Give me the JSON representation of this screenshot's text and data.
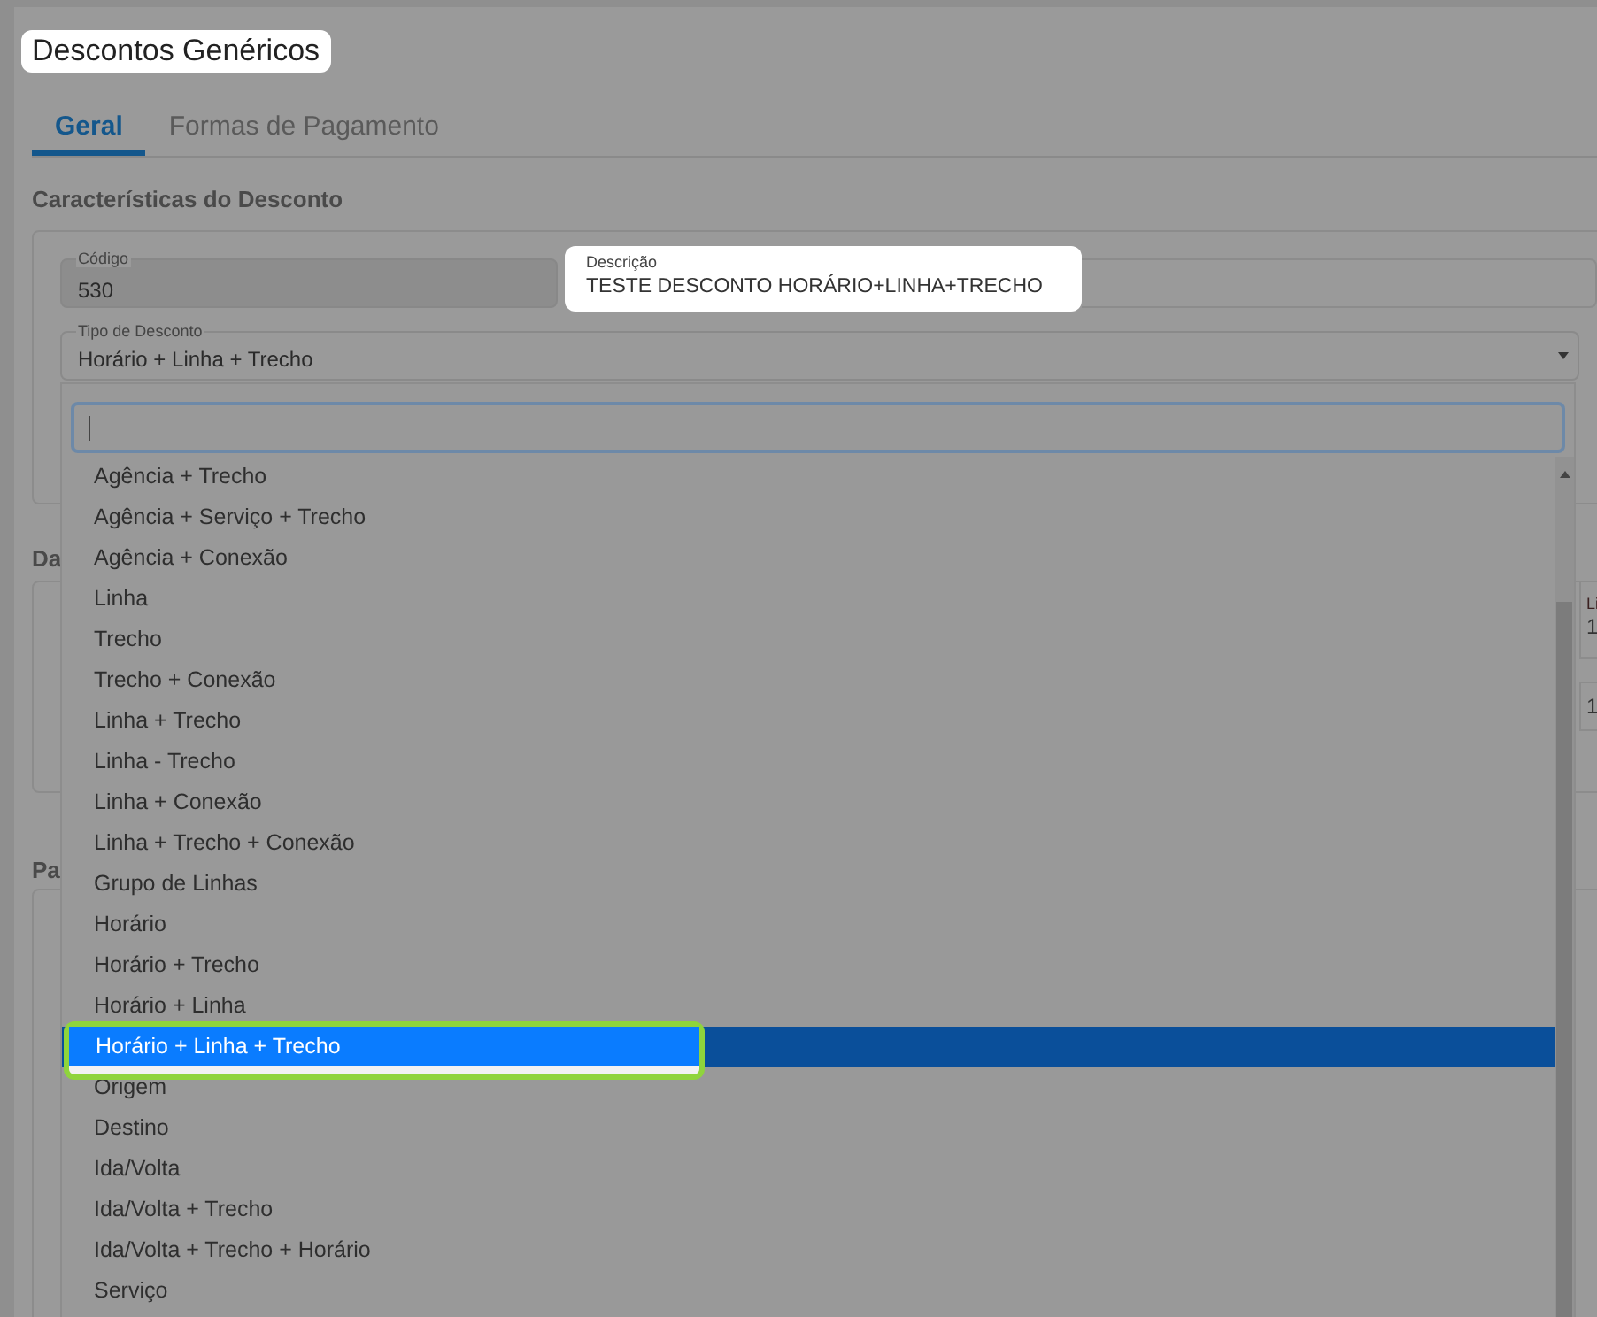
{
  "page_title": "Descontos Genéricos",
  "tabs": [
    {
      "label": "Geral",
      "selected": true
    },
    {
      "label": "Formas de Pagamento",
      "selected": false
    }
  ],
  "section_title": "Características do Desconto",
  "codigo": {
    "label": "Código",
    "value": "530",
    "disabled": true
  },
  "descricao": {
    "label": "Descrição",
    "value": "TESTE DESCONTO HORÁRIO+LINHA+TRECHO"
  },
  "tipo": {
    "label": "Tipo de Desconto",
    "value": "Horário + Linha + Trecho"
  },
  "hidden_section_titles": [
    "Da",
    "Pa"
  ],
  "hidden_field_fragments": [
    {
      "label": "Li",
      "value": "1"
    },
    {
      "value": "1"
    }
  ],
  "options": [
    {
      "label": "Agência + Trecho",
      "selected": false
    },
    {
      "label": "Agência + Serviço + Trecho",
      "selected": false
    },
    {
      "label": "Agência + Conexão",
      "selected": false
    },
    {
      "label": "Linha",
      "selected": false
    },
    {
      "label": "Trecho",
      "selected": false
    },
    {
      "label": "Trecho + Conexão",
      "selected": false
    },
    {
      "label": "Linha + Trecho",
      "selected": false
    },
    {
      "label": "Linha - Trecho",
      "selected": false
    },
    {
      "label": "Linha + Conexão",
      "selected": false
    },
    {
      "label": "Linha + Trecho + Conexão",
      "selected": false
    },
    {
      "label": "Grupo de Linhas",
      "selected": false
    },
    {
      "label": "Horário",
      "selected": false
    },
    {
      "label": "Horário + Trecho",
      "selected": false
    },
    {
      "label": "Horário + Linha",
      "selected": false
    },
    {
      "label": "Horário + Linha + Trecho",
      "selected": true
    },
    {
      "label": "Origem",
      "selected": false
    },
    {
      "label": "Destino",
      "selected": false
    },
    {
      "label": "Ida/Volta",
      "selected": false
    },
    {
      "label": "Ida/Volta + Trecho",
      "selected": false
    },
    {
      "label": "Ida/Volta + Trecho + Horário",
      "selected": false
    },
    {
      "label": "Serviço",
      "selected": false
    }
  ]
}
